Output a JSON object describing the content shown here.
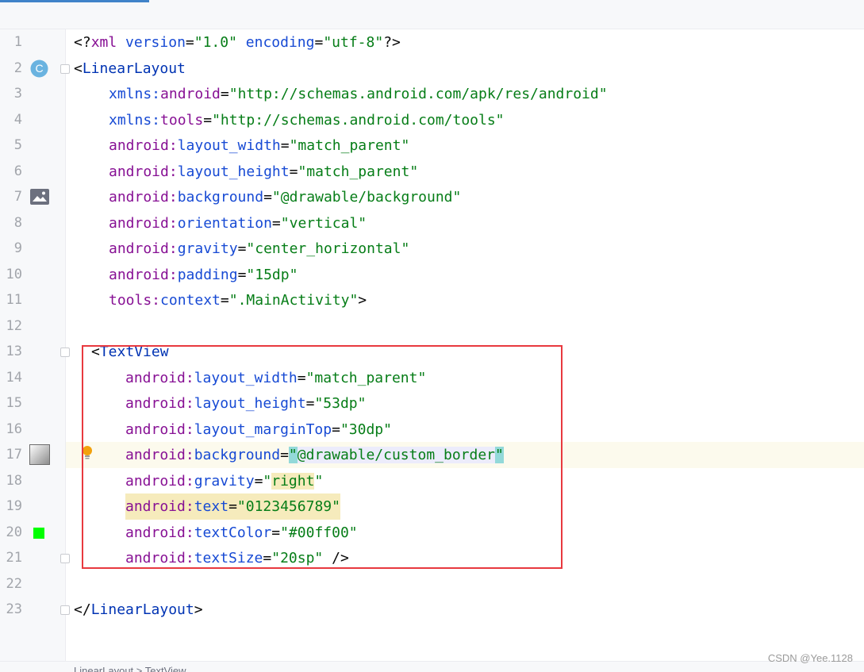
{
  "colors": {
    "tag": "#0033b3",
    "namespace": "#871094",
    "attribute": "#174ad4",
    "string": "#067d17",
    "selection_box": "#e8393f",
    "text_color_swatch": "#00ff00",
    "class_icon": "#6ab3e0"
  },
  "gutter": {
    "class_icon_letter": "C"
  },
  "lines": [
    {
      "n": "1"
    },
    {
      "n": "2"
    },
    {
      "n": "3"
    },
    {
      "n": "4"
    },
    {
      "n": "5"
    },
    {
      "n": "6"
    },
    {
      "n": "7"
    },
    {
      "n": "8"
    },
    {
      "n": "9"
    },
    {
      "n": "10"
    },
    {
      "n": "11"
    },
    {
      "n": "12"
    },
    {
      "n": "13"
    },
    {
      "n": "14"
    },
    {
      "n": "15"
    },
    {
      "n": "16"
    },
    {
      "n": "17"
    },
    {
      "n": "18"
    },
    {
      "n": "19"
    },
    {
      "n": "20"
    },
    {
      "n": "21"
    },
    {
      "n": "22"
    },
    {
      "n": "23"
    }
  ],
  "code": {
    "l1": {
      "open": "<?",
      "xml": "xml",
      "version_attr": "version",
      "version_val": "\"1.0\"",
      "encoding_attr": "encoding",
      "encoding_val": "\"utf-8\"",
      "close": "?>"
    },
    "l2": {
      "open": "<",
      "tag": "LinearLayout"
    },
    "l3": {
      "ns": "xmlns:",
      "attr": "android",
      "eq": "=",
      "val": "\"http://schemas.android.com/apk/res/android\""
    },
    "l4": {
      "ns": "xmlns:",
      "attr": "tools",
      "eq": "=",
      "val": "\"http://schemas.android.com/tools\""
    },
    "l5": {
      "ns": "android:",
      "attr": "layout_width",
      "eq": "=",
      "val": "\"match_parent\""
    },
    "l6": {
      "ns": "android:",
      "attr": "layout_height",
      "eq": "=",
      "val": "\"match_parent\""
    },
    "l7": {
      "ns": "android:",
      "attr": "background",
      "eq": "=",
      "val": "\"@drawable/background\""
    },
    "l8": {
      "ns": "android:",
      "attr": "orientation",
      "eq": "=",
      "val": "\"vertical\""
    },
    "l9": {
      "ns": "android:",
      "attr": "gravity",
      "eq": "=",
      "val": "\"center_horizontal\""
    },
    "l10": {
      "ns": "android:",
      "attr": "padding",
      "eq": "=",
      "val": "\"15dp\""
    },
    "l11": {
      "ns": "tools:",
      "attr": "context",
      "eq": "=",
      "val": "\".MainActivity\"",
      "close": ">"
    },
    "l13": {
      "open": "<",
      "tag": "TextView"
    },
    "l14": {
      "ns": "android:",
      "attr": "layout_width",
      "eq": "=",
      "val": "\"match_parent\""
    },
    "l15": {
      "ns": "android:",
      "attr": "layout_height",
      "eq": "=",
      "val": "\"53dp\""
    },
    "l16": {
      "ns": "android:",
      "attr": "layout_marginTop",
      "eq": "=",
      "val": "\"30dp\""
    },
    "l17": {
      "ns": "android:",
      "attr": "background",
      "eq": "=",
      "q1": "\"",
      "val": "@drawable/custom_border",
      "q2": "\""
    },
    "l18": {
      "ns": "android:",
      "attr": "gravity",
      "eq": "=",
      "q1": "\"",
      "val": "right",
      "q2": "\""
    },
    "l19": {
      "ns": "android:",
      "attr": "text",
      "eq": "=",
      "val": "\"0123456789\""
    },
    "l20": {
      "ns": "android:",
      "attr": "textColor",
      "eq": "=",
      "val": "\"#00ff00\""
    },
    "l21": {
      "ns": "android:",
      "attr": "textSize",
      "eq": "=",
      "val": "\"20sp\"",
      "close": " />"
    },
    "l23": {
      "open": "</",
      "tag": "LinearLayout",
      "close": ">"
    }
  },
  "status": {
    "breadcrumb": "LinearLayout > TextView"
  },
  "watermark": "CSDN @Yee.1128"
}
